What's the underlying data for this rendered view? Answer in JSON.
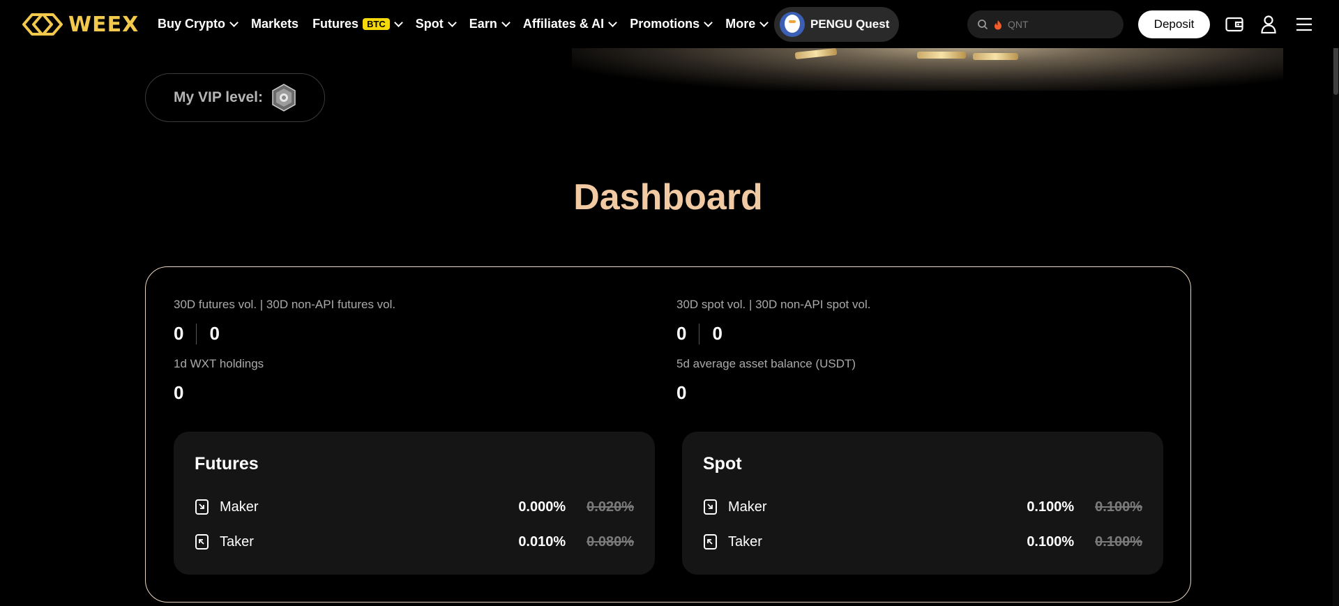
{
  "header": {
    "logo_text": "WEEX",
    "nav": [
      {
        "label": "Buy Crypto",
        "dropdown": true
      },
      {
        "label": "Markets",
        "dropdown": false
      },
      {
        "label": "Futures",
        "badge": "BTC",
        "dropdown": true
      },
      {
        "label": "Spot",
        "dropdown": true
      },
      {
        "label": "Earn",
        "dropdown": true
      },
      {
        "label": "Affiliates & AI",
        "dropdown": true
      },
      {
        "label": "Promotions",
        "dropdown": true
      },
      {
        "label": "More",
        "dropdown": true
      }
    ],
    "quest_label": "PENGU Quest",
    "search_placeholder": "QNT",
    "deposit_label": "Deposit",
    "icons": [
      "search-icon",
      "fire-icon",
      "wallet-icon",
      "user-icon",
      "menu-icon"
    ]
  },
  "vip": {
    "label": "My VIP level:"
  },
  "dashboard": {
    "title": "Dashboard",
    "stats": {
      "futures_vol": {
        "label": "30D futures vol. | 30D non-API futures vol.",
        "value1": "0",
        "value2": "0"
      },
      "spot_vol": {
        "label": "30D spot vol. | 30D non-API spot vol.",
        "value1": "0",
        "value2": "0"
      },
      "wxt": {
        "label": "1d WXT holdings",
        "value": "0"
      },
      "balance": {
        "label": "5d average asset balance (USDT)",
        "value": "0"
      }
    },
    "futures": {
      "title": "Futures",
      "maker": {
        "label": "Maker",
        "rate": "0.000%",
        "original": "0.020%"
      },
      "taker": {
        "label": "Taker",
        "rate": "0.010%",
        "original": "0.080%"
      }
    },
    "spot": {
      "title": "Spot",
      "maker": {
        "label": "Maker",
        "rate": "0.100%",
        "original": "0.100%"
      },
      "taker": {
        "label": "Taker",
        "rate": "0.100%",
        "original": "0.100%"
      }
    }
  },
  "colors": {
    "brand": "#f2c94c",
    "title": "#f1c9a2",
    "card_border": "#e9d6c1",
    "panel_bg": "#151515"
  }
}
